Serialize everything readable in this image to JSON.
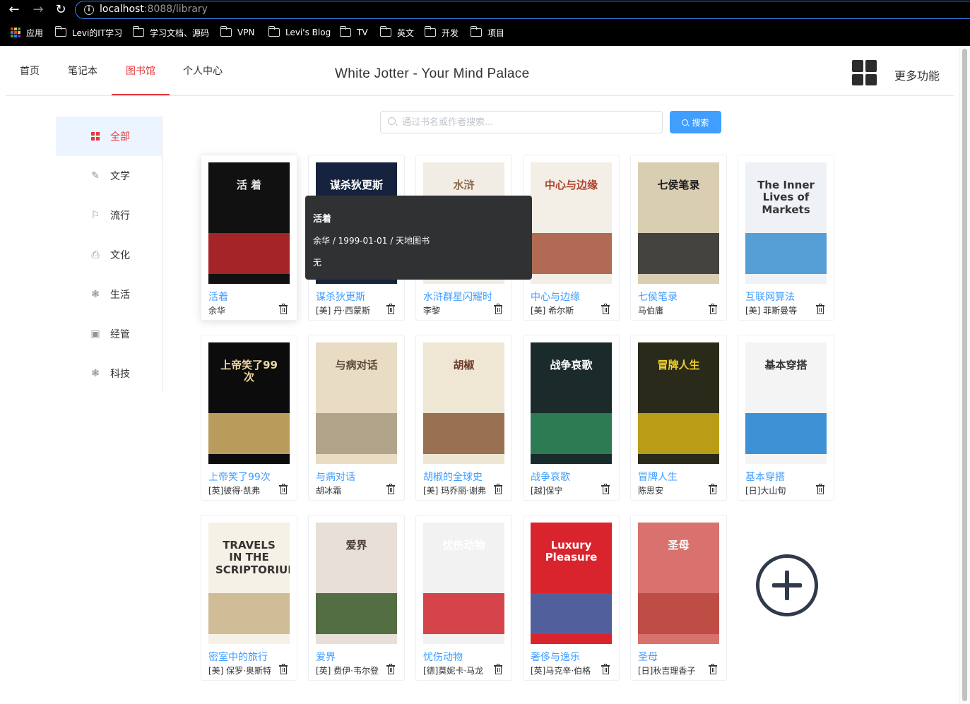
{
  "browser": {
    "url_host": "localhost",
    "url_rest": ":8088/library",
    "bookmarks": [
      "应用",
      "Levi的IT学习",
      "学习文档、源码",
      "VPN",
      "Levi's Blog",
      "TV",
      "英文",
      "开发",
      "项目"
    ]
  },
  "header": {
    "nav": [
      "首页",
      "笔记本",
      "图书馆",
      "个人中心"
    ],
    "active_nav": "图书馆",
    "title": "White Jotter - Your Mind Palace",
    "more_label": "更多功能"
  },
  "sidebar": {
    "items": [
      {
        "label": "全部",
        "icon": "grid-icon",
        "active": true
      },
      {
        "label": "文学",
        "icon": "pen-icon"
      },
      {
        "label": "流行",
        "icon": "flag-icon"
      },
      {
        "label": "文化",
        "icon": "printer-icon"
      },
      {
        "label": "生活",
        "icon": "loading-icon"
      },
      {
        "label": "经管",
        "icon": "picture-icon"
      },
      {
        "label": "科技",
        "icon": "loading-icon"
      }
    ]
  },
  "search": {
    "placeholder": "通过书名或作者搜索...",
    "button_label": "搜索"
  },
  "tooltip": {
    "title": "活着",
    "meta": "余华 / 1999-01-01 / 天地图书",
    "desc": "无"
  },
  "books": [
    {
      "title": "活着",
      "author": "余华",
      "cover_text": "活 着",
      "bg": "#111111",
      "fg": "#e6e6e6",
      "accent": "#c0282d"
    },
    {
      "title": "谋杀狄更斯",
      "author": "[美] 丹·西蒙斯",
      "cover_text": "谋杀狄更斯",
      "bg": "#15233e",
      "fg": "#ffffff",
      "accent": "#c8242b"
    },
    {
      "title": "水浒群星闪耀时",
      "author": "李黎",
      "cover_text": "水浒",
      "bg": "#f2ede4",
      "fg": "#8a6a4a",
      "accent": "#d1242a"
    },
    {
      "title": "中心与边缘",
      "author": "[美] 希尔斯",
      "cover_text": "中心与边缘",
      "bg": "#f3eee6",
      "fg": "#b0422b",
      "accent": "#a5533a"
    },
    {
      "title": "七侯笔录",
      "author": "马伯庸",
      "cover_text": "七侯笔录",
      "bg": "#d9cdb2",
      "fg": "#1a1a1a",
      "accent": "#2a2a2a"
    },
    {
      "title": "互联网算法",
      "author": "[美] 菲斯曼等",
      "cover_text": "The Inner Lives of Markets",
      "bg": "#eef1f5",
      "fg": "#333333",
      "accent": "#3b8fd0"
    },
    {
      "title": "上帝笑了99次",
      "author": "[英]彼得·凯弗",
      "cover_text": "上帝笑了99次",
      "bg": "#0c0c0c",
      "fg": "#f0d7a0",
      "accent": "#d8b56a"
    },
    {
      "title": "与病对话",
      "author": "胡冰霜",
      "cover_text": "与病对话",
      "bg": "#e8dcc4",
      "fg": "#5a4a3a",
      "accent": "#a89a80"
    },
    {
      "title": "胡椒的全球史",
      "author": "[美] 玛乔丽·谢弗",
      "cover_text": "胡椒",
      "bg": "#efe6d4",
      "fg": "#6a3a2a",
      "accent": "#8a5a3a"
    },
    {
      "title": "战争哀歌",
      "author": "[越]保宁",
      "cover_text": "战争哀歌",
      "bg": "#1b2a2a",
      "fg": "#ffffff",
      "accent": "#2f8a5a"
    },
    {
      "title": "冒牌人生",
      "author": "陈思安",
      "cover_text": "冒牌人生",
      "bg": "#2a2a1a",
      "fg": "#f2d12a",
      "accent": "#d4b016"
    },
    {
      "title": "基本穿搭",
      "author": "[日]大山旬",
      "cover_text": "基本穿搭",
      "bg": "#f4f4f4",
      "fg": "#333333",
      "accent": "#1e7fd0"
    },
    {
      "title": "密室中的旅行",
      "author": "[美] 保罗·奥斯特",
      "cover_text": "TRAVELS IN THE SCRIPTORIUM",
      "bg": "#f5f1e6",
      "fg": "#333333",
      "accent": "#c9b48a"
    },
    {
      "title": "爱界",
      "author": "[英] 费伊·韦尔登",
      "cover_text": "爱界",
      "bg": "#e7dfd8",
      "fg": "#4a3a3a",
      "accent": "#3a5a2a"
    },
    {
      "title": "忧伤动物",
      "author": "[德]莫妮卡·马龙",
      "cover_text": "忧伤动物",
      "bg": "#f2f2f2",
      "fg": "#ffffff",
      "accent": "#d0262d"
    },
    {
      "title": "奢侈与逸乐",
      "author": "[英]马克辛·伯格",
      "cover_text": "Luxury Pleasure",
      "bg": "#d9242e",
      "fg": "#ffffff",
      "accent": "#3a6ab0"
    },
    {
      "title": "圣母",
      "author": "[日]秋吉理香子",
      "cover_text": "圣母",
      "bg": "#d9726e",
      "fg": "#ffffff",
      "accent": "#b8463f"
    }
  ]
}
